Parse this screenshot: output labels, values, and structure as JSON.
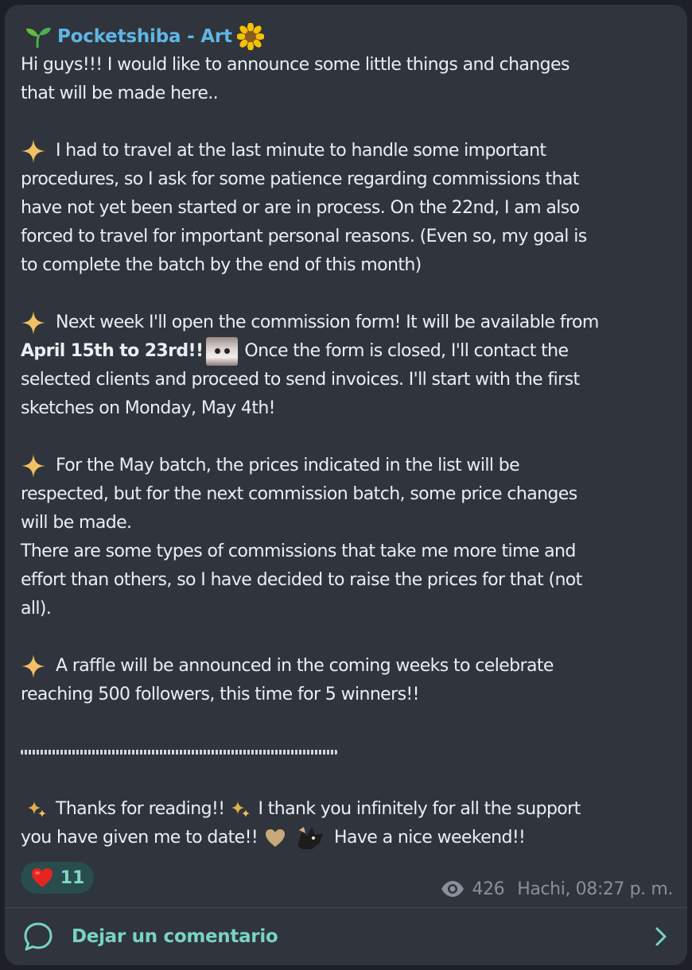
{
  "channel": {
    "title": "Pocketshiba - Art"
  },
  "message": {
    "lines": [
      "Hi guys!!! I would like to announce some little things and changes",
      "that will be made here..",
      "I had to travel at the last minute to handle some important",
      "procedures, so I ask for some patience regarding commissions that",
      "have not yet been started or are in process. On the 22nd, I am also",
      "forced to travel for important personal reasons. (Even so, my goal is",
      "to complete the batch by the end of this month)",
      "Next week I'll open the commission form! It will be available from",
      "April 15th to 23rd!!",
      "Once the form is closed, I'll contact the",
      "selected clients and proceed to send invoices. I'll start with the first",
      "sketches on Monday, May 4th!",
      "For the May batch, the prices indicated in the list will be",
      "respected, but for the next commission batch, some price changes",
      "will be made.",
      "There are some types of commissions that take me more time and",
      "effort than others, so I have decided to raise the prices for that (not",
      "all).",
      "A raffle will be announced in the coming weeks to celebrate",
      "reaching 500 followers, this time for 5 winners!!",
      "Thanks for reading!!",
      "I thank you infinitely for all the support",
      "you have given me to date!!",
      "Have a nice weekend!!"
    ]
  },
  "reaction": {
    "count": "11",
    "icon": "red-heart-icon"
  },
  "meta": {
    "views": "426",
    "author_time": "Hachi, 08:27 p. m."
  },
  "comments": {
    "label": "Dejar un comentario"
  },
  "colors": {
    "background": "#1d2026",
    "card": "#30343c",
    "title": "#5fb6e6",
    "accent": "#78d3c3",
    "reaction_bg": "#294c4c",
    "meta_text": "#8a9099"
  }
}
